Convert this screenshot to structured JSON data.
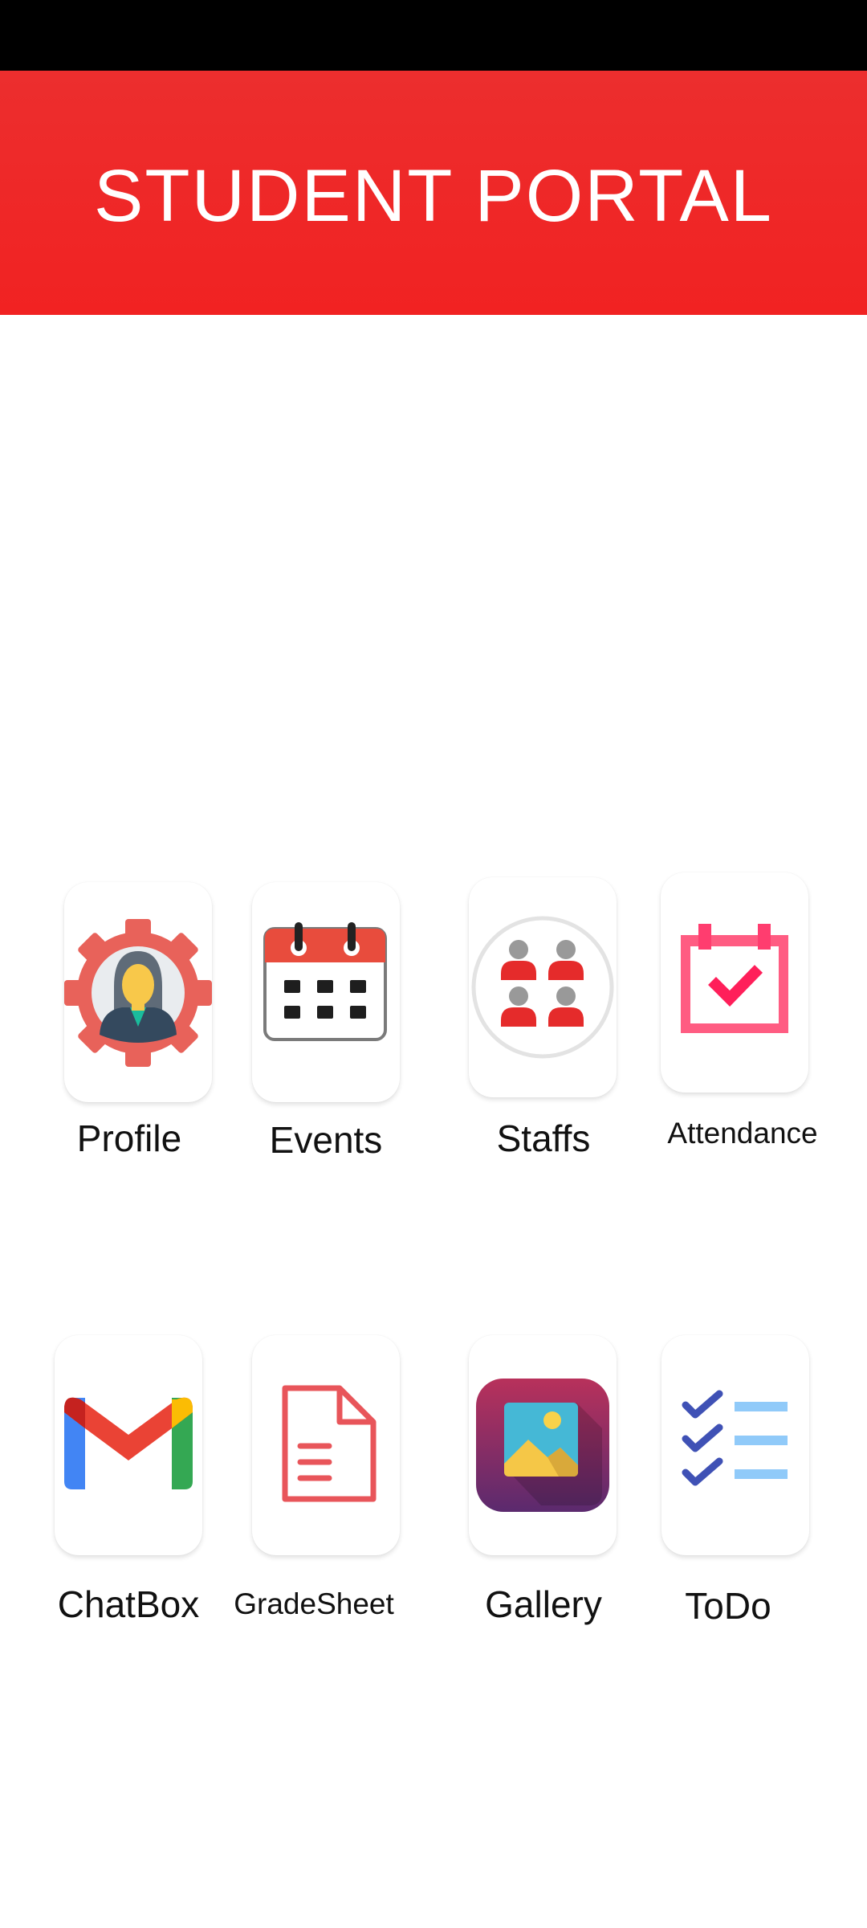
{
  "header": {
    "title": "STUDENT PORTAL",
    "color": "#f12222"
  },
  "menu": [
    {
      "label": "Profile",
      "icon": "profile-gear-icon"
    },
    {
      "label": "Events",
      "icon": "calendar-icon"
    },
    {
      "label": "Staffs",
      "icon": "staff-group-icon"
    },
    {
      "label": "Attendance",
      "icon": "attendance-check-icon"
    },
    {
      "label": "ChatBox",
      "icon": "gmail-icon"
    },
    {
      "label": "GradeSheet",
      "icon": "document-icon"
    },
    {
      "label": "Gallery",
      "icon": "gallery-image-icon"
    },
    {
      "label": "ToDo",
      "icon": "checklist-icon"
    }
  ]
}
